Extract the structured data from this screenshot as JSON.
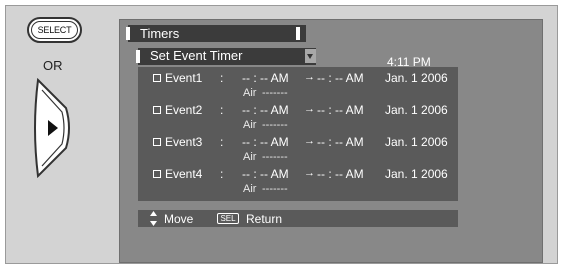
{
  "remote": {
    "select_button_label": "SELECT",
    "or_label": "OR",
    "dpad_icon": "right-arrow-icon"
  },
  "menu": {
    "title": "Timers",
    "submenu_label": "Set Event Timer",
    "submenu_icon": "dropdown-arrow-icon",
    "current_time": "4:11 PM",
    "events": [
      {
        "label": "Event1",
        "colon": ":",
        "start": "-- : -- AM",
        "arrow": "→",
        "end": "-- : -- AM",
        "date": "Jan. 1 2006",
        "channel_label": "Air",
        "channel_value": "-------"
      },
      {
        "label": "Event2",
        "colon": ":",
        "start": "-- : -- AM",
        "arrow": "→",
        "end": "-- : -- AM",
        "date": "Jan. 1 2006",
        "channel_label": "Air",
        "channel_value": "-------"
      },
      {
        "label": "Event3",
        "colon": ":",
        "start": "-- : -- AM",
        "arrow": "→",
        "end": "-- : -- AM",
        "date": "Jan. 1 2006",
        "channel_label": "Air",
        "channel_value": "-------"
      },
      {
        "label": "Event4",
        "colon": ":",
        "start": "-- : -- AM",
        "arrow": "→",
        "end": "-- : -- AM",
        "date": "Jan. 1 2006",
        "channel_label": "Air",
        "channel_value": "-------"
      }
    ],
    "footer": {
      "move_label": "Move",
      "sel_badge": "SEL",
      "return_label": "Return"
    }
  },
  "colors": {
    "outer_bg": "#d3d3d3",
    "panel_bg": "#888888",
    "list_bg": "#5a5a5a",
    "title_bg": "#3b3b3b",
    "text": "#ffffff"
  }
}
